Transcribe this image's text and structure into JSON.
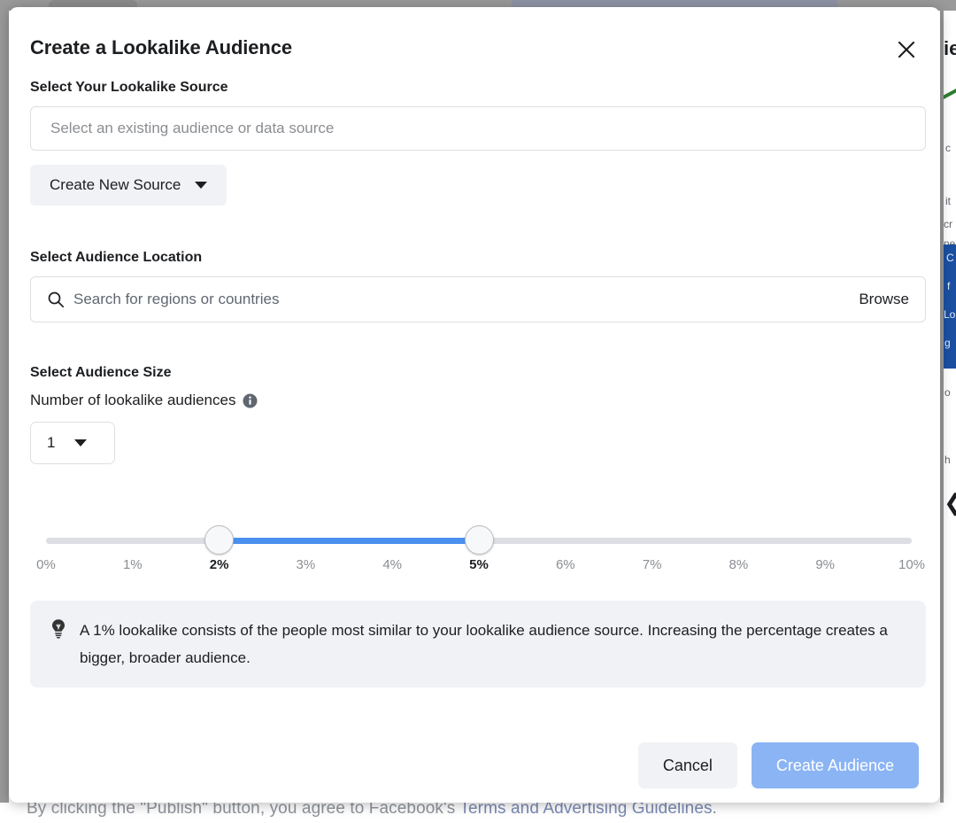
{
  "background": {
    "footer_text_prefix": "By clicking the \"Publish\" button, you agree to Facebook's ",
    "footer_link_text": "Terms and Advertising Guidelines.",
    "fragments": [
      {
        "text": "ie",
        "style": "big"
      },
      {
        "text": "c",
        "style": "small"
      },
      {
        "text": "it",
        "style": "small"
      },
      {
        "text": "cr",
        "style": "small"
      },
      {
        "text": "ne",
        "style": "small"
      },
      {
        "text": "C",
        "style": "small"
      },
      {
        "text": "f",
        "style": "small"
      },
      {
        "text": "Lo",
        "style": "small"
      },
      {
        "text": "g",
        "style": "small"
      },
      {
        "text": "o",
        "style": "small"
      },
      {
        "text": "h",
        "style": "small"
      }
    ],
    "chevron": "❮"
  },
  "modal": {
    "title": "Create a Lookalike Audience",
    "close_icon": "close-icon",
    "source": {
      "heading": "Select Your Lookalike Source",
      "input_value": "",
      "input_placeholder": "Select an existing audience or data source",
      "create_button_label": "Create New Source"
    },
    "location": {
      "heading": "Select Audience Location",
      "search_value": "",
      "search_placeholder": "Search for regions or countries",
      "browse_label": "Browse",
      "search_icon": "search-icon"
    },
    "size": {
      "heading": "Select Audience Size",
      "number_label": "Number of lookalike audiences",
      "info_icon": "info-icon",
      "number_value": "1"
    },
    "slider": {
      "min_percent": 0,
      "max_percent": 10,
      "lower_value": 2,
      "upper_value": 5,
      "track_color": "#dcdee3",
      "fill_color": "#4a90f0",
      "ticks": [
        {
          "label": "0%",
          "value": 0,
          "active": false
        },
        {
          "label": "1%",
          "value": 1,
          "active": false
        },
        {
          "label": "2%",
          "value": 2,
          "active": true
        },
        {
          "label": "3%",
          "value": 3,
          "active": false
        },
        {
          "label": "4%",
          "value": 4,
          "active": false
        },
        {
          "label": "5%",
          "value": 5,
          "active": true
        },
        {
          "label": "6%",
          "value": 6,
          "active": false
        },
        {
          "label": "7%",
          "value": 7,
          "active": false
        },
        {
          "label": "8%",
          "value": 8,
          "active": false
        },
        {
          "label": "9%",
          "value": 9,
          "active": false
        },
        {
          "label": "10%",
          "value": 10,
          "active": false
        }
      ]
    },
    "tip": {
      "icon": "lightbulb-icon",
      "text": "A 1% lookalike consists of the people most similar to your lookalike audience source. Increasing the percentage creates a bigger, broader audience."
    },
    "footer": {
      "cancel_label": "Cancel",
      "primary_label": "Create Audience",
      "primary_color": "#8ab4f4"
    }
  }
}
